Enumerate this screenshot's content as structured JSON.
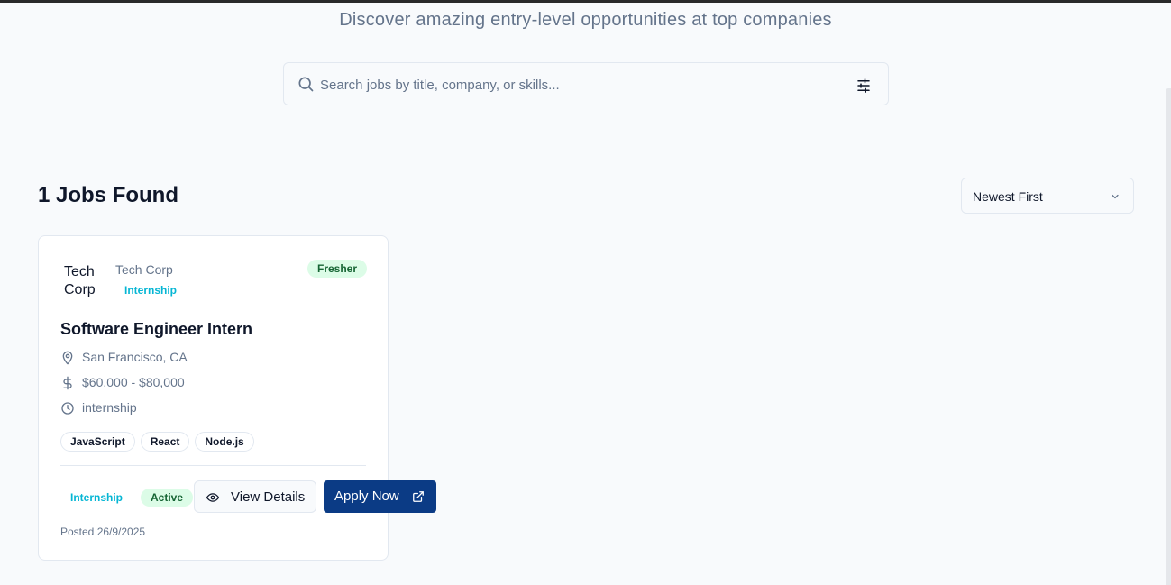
{
  "hero": {
    "subtitle": "Discover amazing entry-level opportunities at top companies"
  },
  "search": {
    "placeholder": "Search jobs by title, company, or skills...",
    "value": ""
  },
  "results": {
    "count_label": "1 Jobs Found",
    "sort_selected": "Newest First"
  },
  "job": {
    "logo_text_line1": "Tech",
    "logo_text_line2": "Corp",
    "company": "Tech Corp",
    "type_tag": "Internship",
    "level_badge": "Fresher",
    "title": "Software Engineer Intern",
    "location": "San Francisco, CA",
    "salary": "$60,000 - $80,000",
    "employment_type": "internship",
    "skills": [
      "JavaScript",
      "React",
      "Node.js"
    ],
    "footer_type_chip": "Internship",
    "status_chip": "Active",
    "view_details_label": "View Details",
    "apply_label": "Apply Now",
    "posted": "Posted 26/9/2025"
  },
  "colors": {
    "accent_navy": "#0b3b85",
    "tag_cyan": "#06b6d4",
    "badge_green_bg": "#dcfce7",
    "badge_green_text": "#166534",
    "muted_text": "#64748b"
  },
  "icons": {
    "search": "search-icon",
    "filter": "sliders-icon",
    "sort": "chevron-down-icon",
    "location": "map-pin-icon",
    "salary": "dollar-icon",
    "type": "clock-icon",
    "view": "eye-icon",
    "apply": "external-link-icon"
  }
}
